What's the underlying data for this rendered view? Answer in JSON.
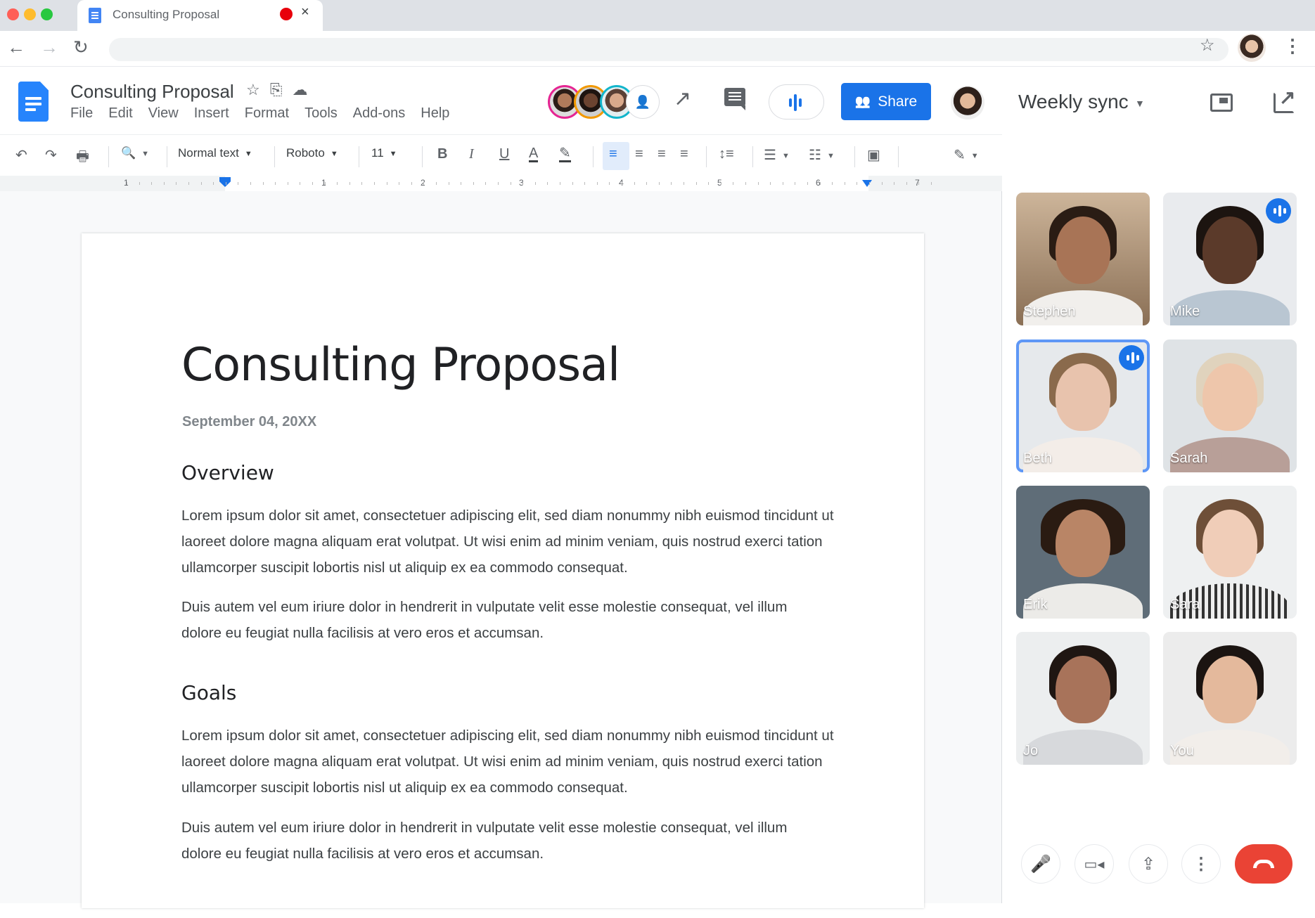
{
  "browser": {
    "tab_title": "Consulting Proposal",
    "tab_close": "×",
    "nav": {
      "back": "←",
      "forward": "→",
      "reload": "↻"
    },
    "address": "",
    "bookmark": "☆",
    "menu": "⋮"
  },
  "docs": {
    "title": "Consulting Proposal",
    "title_icons": "☆ ⎘ ☁",
    "menu": [
      "File",
      "Edit",
      "View",
      "Insert",
      "Format",
      "Tools",
      "Add-ons",
      "Help"
    ],
    "share_label": "Share",
    "share_icon": "👥",
    "trend_icon": "↗",
    "collaborator_colors": [
      "#e52592",
      "#f29900",
      "#12b5cb"
    ],
    "accent": "#1a73e8"
  },
  "toolbar": {
    "undo": "↶",
    "redo": "↷",
    "print": "🖶",
    "zoom": "🔍",
    "style": "Normal text",
    "font": "Roboto",
    "size": "11",
    "bold": "B",
    "italic": "I",
    "underline": "U",
    "text_color": "A",
    "highlight": "✎",
    "align_left": "≡",
    "align_center": "≡",
    "align_right": "≡",
    "justify": "≡",
    "line_spacing": "↕≡",
    "bullets": "☰",
    "numbered": "☷",
    "image": "▣",
    "editing": "✎",
    "caret": "▼"
  },
  "ruler": {
    "labels": [
      "1",
      "1",
      "2",
      "3",
      "4",
      "5",
      "6",
      "7"
    ]
  },
  "document": {
    "title": "Consulting Proposal",
    "date": "September 04, 20XX",
    "sections": [
      {
        "heading": "Overview",
        "paragraphs": [
          "Lorem ipsum dolor sit amet, consectetuer adipiscing elit, sed diam nonummy nibh euismod tincidunt ut laoreet dolore magna aliquam erat volutpat. Ut wisi enim ad minim veniam, quis nostrud exerci tation ullamcorper suscipit lobortis nisl ut aliquip ex ea commodo consequat.",
          "Duis autem vel eum iriure dolor in hendrerit in vulputate velit esse molestie consequat, vel illum dolore eu feugiat nulla facilisis at vero eros et accumsan."
        ]
      },
      {
        "heading": "Goals",
        "paragraphs": [
          "Lorem ipsum dolor sit amet, consectetuer adipiscing elit, sed diam nonummy nibh euismod tincidunt ut laoreet dolore magna aliquam erat volutpat. Ut wisi enim ad minim veniam, quis nostrud exerci tation ullamcorper suscipit lobortis nisl ut aliquip ex ea commodo consequat.",
          "Duis autem vel eum iriure dolor in hendrerit in vulputate velit esse molestie consequat, vel illum dolore eu feugiat nulla facilisis at vero eros et accumsan."
        ]
      }
    ]
  },
  "meet": {
    "title": "Weekly sync",
    "caret": "▼",
    "participants": [
      {
        "name": "Stephen",
        "speaking": false,
        "active": false
      },
      {
        "name": "Mike",
        "speaking": true,
        "active": false
      },
      {
        "name": "Beth",
        "speaking": true,
        "active": true
      },
      {
        "name": "Sarah",
        "speaking": false,
        "active": false
      },
      {
        "name": "Erik",
        "speaking": false,
        "active": false
      },
      {
        "name": "Sara",
        "speaking": false,
        "active": false
      },
      {
        "name": "Jo",
        "speaking": false,
        "active": false
      },
      {
        "name": "You",
        "speaking": false,
        "active": false
      }
    ],
    "controls": {
      "mic": "🎤",
      "camera": "▭◂",
      "present": "⇪",
      "more": "⋮"
    },
    "end_call_color": "#ea4335"
  }
}
